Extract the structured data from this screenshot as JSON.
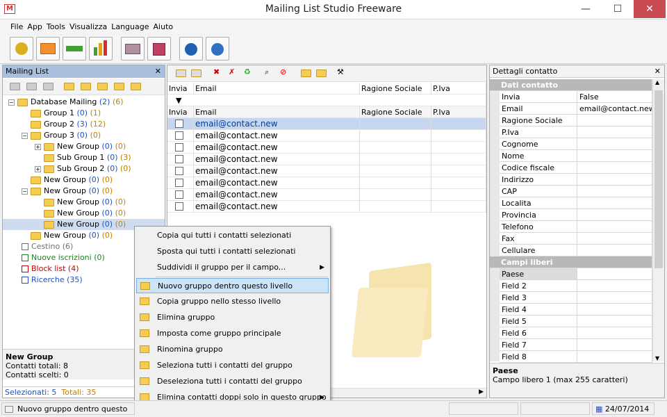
{
  "window": {
    "title": "Mailing List Studio Freeware",
    "minimize": "—",
    "maximize": "☐",
    "close": "✕"
  },
  "menu": [
    "File",
    "App",
    "Tools",
    "Visualizza",
    "Language",
    "Aiuto"
  ],
  "left": {
    "header": "Mailing List",
    "close": "✕",
    "tree": [
      {
        "label": "Database Mailing",
        "a": "(2)",
        "b": "(6)"
      },
      {
        "label": "Group 1",
        "a": "(0)",
        "b": "(1)"
      },
      {
        "label": "Group 2",
        "a": "(3)",
        "b": "(12)"
      },
      {
        "label": "Group 3",
        "a": "(0)",
        "b": "(0)"
      },
      {
        "label": "New Group",
        "a": "(0)",
        "b": "(0)"
      },
      {
        "label": "Sub Group 1",
        "a": "(0)",
        "b": "(3)"
      },
      {
        "label": "Sub Group 2",
        "a": "(0)",
        "b": "(0)"
      },
      {
        "label": "New Group",
        "a": "(0)",
        "b": "(0)"
      },
      {
        "label": "New Group",
        "a": "(0)",
        "b": "(0)"
      },
      {
        "label": "New Group",
        "a": "(0)",
        "b": "(0)"
      },
      {
        "label": "New Group",
        "a": "(0)",
        "b": "(0)"
      },
      {
        "label": "New Group",
        "a": "(0)",
        "b": "(0)"
      },
      {
        "label": "New Group",
        "a": "(0)",
        "b": "(0)"
      }
    ],
    "specials": [
      {
        "label": "Cestino (6)",
        "color": "#707070"
      },
      {
        "label": "Nuove iscrizioni (0)",
        "color": "#208020"
      },
      {
        "label": "Block list (4)",
        "color": "#c00000"
      },
      {
        "label": "Ricerche (35)",
        "color": "#2050c0"
      }
    ],
    "info": {
      "title": "New Group",
      "total": "Contatti totali: 8",
      "chosen": "Contatti scelti: 0"
    },
    "selected": "Selezionati: 5",
    "total": "Totali: 35"
  },
  "grid": {
    "headers": [
      "Invia",
      "Email",
      "Ragione Sociale",
      "P.Iva"
    ],
    "filter_icon": "▼",
    "rows": [
      "email@contact.new",
      "email@contact.new",
      "email@contact.new",
      "email@contact.new",
      "email@contact.new",
      "email@contact.new",
      "email@contact.new",
      "email@contact.new"
    ]
  },
  "details": {
    "header": "Dettagli contatto",
    "close": "✕",
    "cat1": "Dati contatto",
    "cat2": "Campi liberi",
    "props": [
      [
        "Invia",
        "False"
      ],
      [
        "Email",
        "email@contact.new"
      ],
      [
        "Ragione Sociale",
        ""
      ],
      [
        "P.Iva",
        ""
      ],
      [
        "Cognome",
        ""
      ],
      [
        "Nome",
        ""
      ],
      [
        "Codice fiscale",
        ""
      ],
      [
        "Indirizzo",
        ""
      ],
      [
        "CAP",
        ""
      ],
      [
        "Localita",
        ""
      ],
      [
        "Provincia",
        ""
      ],
      [
        "Telefono",
        ""
      ],
      [
        "Fax",
        ""
      ],
      [
        "Cellulare",
        ""
      ]
    ],
    "free": [
      "Paese",
      "Field 2",
      "Field 3",
      "Field 4",
      "Field 5",
      "Field 6",
      "Field 7",
      "Field 8"
    ],
    "desc_title": "Paese",
    "desc": "Campo libero 1 (max 255 caratteri)"
  },
  "context": [
    "Copia qui tutti i contatti selezionati",
    "Sposta qui tutti i contatti selezionati",
    "Suddividi il gruppo per il campo...",
    "Nuovo gruppo dentro questo livello",
    "Copia gruppo nello stesso livello",
    "Elimina gruppo",
    "Imposta come gruppo principale",
    "Rinomina gruppo",
    "Seleziona tutti i contatti del gruppo",
    "Deseleziona tutti i contatti del gruppo",
    "Elimina contatti doppi solo in questo gruppo"
  ],
  "status": {
    "text": "Nuovo gruppo dentro questo livello",
    "date": "24/07/2014"
  }
}
